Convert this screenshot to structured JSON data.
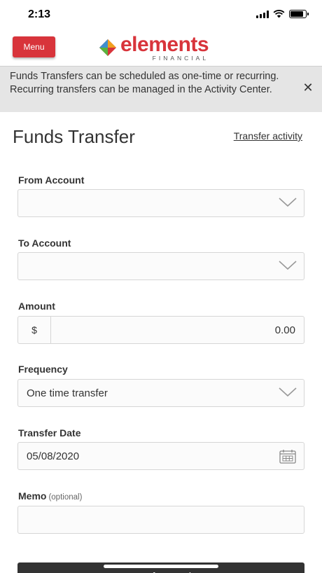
{
  "status_bar": {
    "time": "2:13"
  },
  "header": {
    "menu_label": "Menu",
    "logo_word": "elements",
    "logo_sub": "FINANCIAL",
    "brand_color": "#d8343b"
  },
  "banner": {
    "text": "Funds Transfers can be scheduled as one-time or recurring. Recurring transfers can be managed in the Activity Center.",
    "close_icon": "close-icon"
  },
  "page": {
    "title": "Funds Transfer",
    "activity_link": "Transfer activity"
  },
  "form": {
    "from_account": {
      "label": "From Account",
      "value": ""
    },
    "to_account": {
      "label": "To Account",
      "value": ""
    },
    "amount": {
      "label": "Amount",
      "prefix": "$",
      "value": "0.00"
    },
    "frequency": {
      "label": "Frequency",
      "value": "One time transfer"
    },
    "transfer_date": {
      "label": "Transfer Date",
      "value": "05/08/2020"
    },
    "memo": {
      "label": "Memo",
      "optional": "(optional)",
      "value": ""
    },
    "submit_label": "Transfer Funds"
  }
}
